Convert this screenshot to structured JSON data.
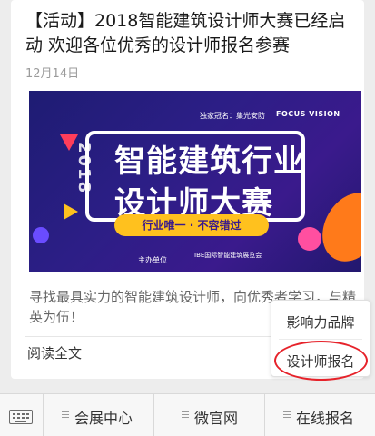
{
  "article": {
    "title": "【活动】2018智能建筑设计师大赛已经启动 欢迎各位优秀的设计师报名参赛",
    "date": "12月14日",
    "description": "寻找最具实力的智能建筑设计师，向优秀者学习，与精英为伍！",
    "read_all": "阅读全文"
  },
  "banner": {
    "sponsor": "独家冠名：集光安防",
    "sponsor_logo": "FOCUS VISION",
    "year": "2018",
    "line1": "智能建筑行业",
    "line2": "设计师大赛",
    "slogan": "行业唯一 · 不容错过",
    "organizer_label": "主办单位",
    "organizer_name": "IBE国际智能建筑展览会"
  },
  "popup_menu": {
    "items": [
      "影响力品牌",
      "设计师报名"
    ],
    "highlight_color": "#e6222a"
  },
  "bottom_menu": {
    "keyboard_icon": "keyboard-icon",
    "tabs": [
      "会展中心",
      "微官网",
      "在线报名"
    ]
  }
}
